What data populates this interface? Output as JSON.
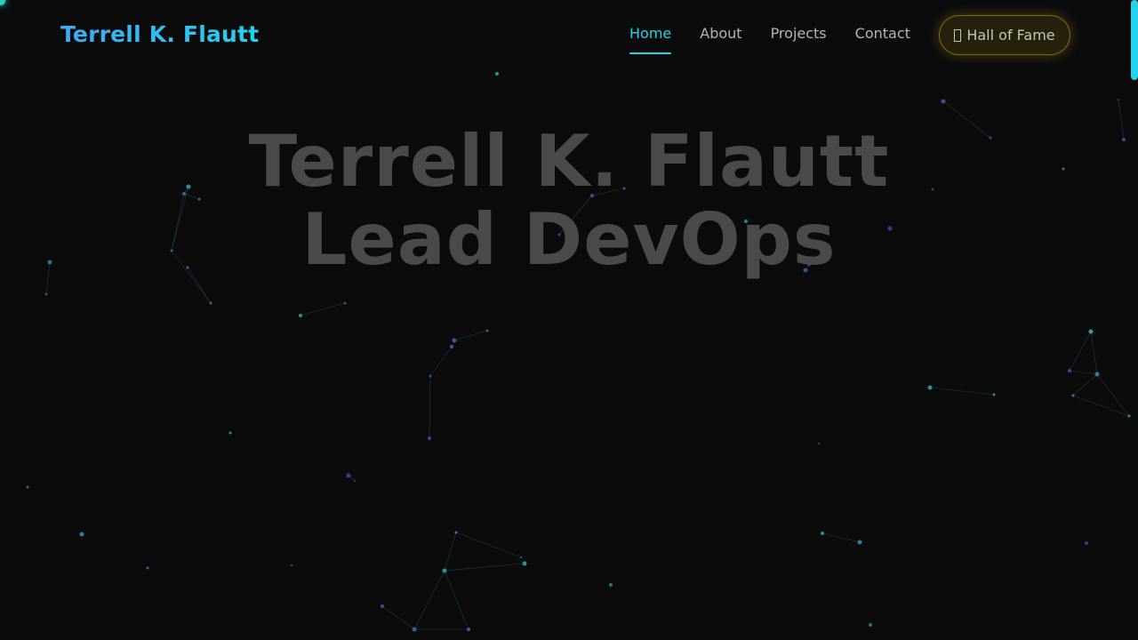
{
  "brand": {
    "name": "Terrell K. Flautt"
  },
  "nav": {
    "items": [
      {
        "label": "Home",
        "active": true
      },
      {
        "label": "About",
        "active": false
      },
      {
        "label": "Projects",
        "active": false
      },
      {
        "label": "Contact",
        "active": false
      }
    ],
    "cta": {
      "label": "Hall of Fame",
      "icon": "trophy-icon"
    }
  },
  "hero": {
    "line1": "Terrell K. Flautt",
    "line2": "Lead DevOps"
  },
  "colors": {
    "accent": "#22d3ee",
    "gold": "#caa81e",
    "background": "#0b0b0c",
    "hero_text": "#4a4a4a"
  }
}
